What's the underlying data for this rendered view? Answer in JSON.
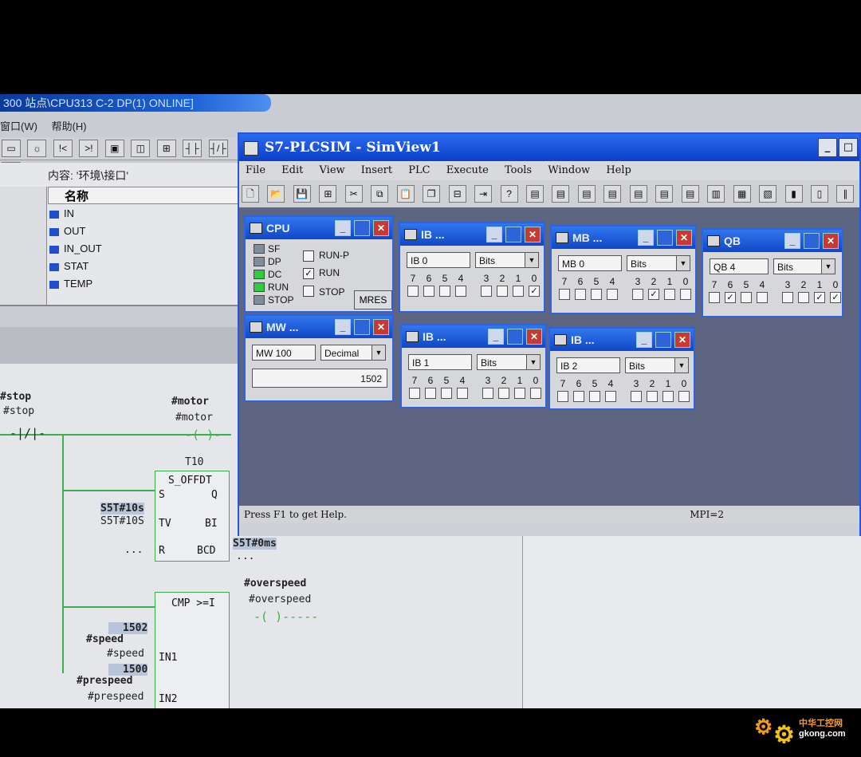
{
  "editor": {
    "title": "300 站点\\CPU313 C-2 DP(1)  ONLINE]",
    "menu": [
      "窗口(W)",
      "帮助(H)"
    ],
    "toolbar_icons": [
      "step-icon",
      "online-icon",
      "left-arrow-icon",
      "right-arrow-icon",
      "window-icon",
      "monitor-icon",
      "network-icon",
      "contact-icon",
      "neg-contact-icon",
      "coil-icon"
    ],
    "interface_header": "内容: '环境\\接口'",
    "column_header": "名称",
    "interface_rows": [
      "IN",
      "OUT",
      "IN_OUT",
      "STAT",
      "TEMP"
    ]
  },
  "ladder": {
    "stop_label_top": "#stop",
    "stop_label": "#stop",
    "motor_label_top": "#motor",
    "motor_label": "#motor",
    "timer_name": "T10",
    "timer_type": "S_OFFDT",
    "pin_s": "S",
    "pin_q": "Q",
    "pin_tv": "TV",
    "pin_bi": "BI",
    "pin_r": "R",
    "pin_bcd": "BCD",
    "tv_value": "S5T#10s",
    "tv_operand": "S5T#10S",
    "r_operand": "...",
    "bi_operand": "...",
    "bcd_value": "S5T#0ms",
    "bcd_operand": "...",
    "cmp_type": "CMP >=I",
    "overspeed_top": "#overspeed",
    "overspeed": "#overspeed",
    "speed_value": "1502",
    "speed_top": "#speed",
    "speed": "#speed",
    "pin_in1": "IN1",
    "prespeed_value": "1500",
    "prespeed_top": "#prespeed",
    "prespeed": "#prespeed",
    "pin_in2": "IN2"
  },
  "plcsim": {
    "title": "S7-PLCSIM - SimView1",
    "menu": [
      "File",
      "Edit",
      "View",
      "Insert",
      "PLC",
      "Execute",
      "Tools",
      "Window",
      "Help"
    ],
    "status_text": "Press F1 to get Help.",
    "status_mpi": "MPI=2",
    "cpu": {
      "title": "CPU",
      "leds": [
        {
          "label": "SF",
          "color": "#7f8c99"
        },
        {
          "label": "DP",
          "color": "#7f8c99"
        },
        {
          "label": "DC",
          "color": "#2ecc40"
        },
        {
          "label": "RUN",
          "color": "#2ecc40"
        },
        {
          "label": "STOP",
          "color": "#7f8c99"
        }
      ],
      "mode_runp": "RUN-P",
      "mode_run": "RUN",
      "mode_stop": "STOP",
      "mres": "MRES"
    },
    "ib0": {
      "title": "IB ...",
      "area": "IB  0",
      "format": "Bits",
      "checked": [
        false,
        false,
        false,
        false,
        false,
        false,
        false,
        true
      ]
    },
    "mb0": {
      "title": "MB ...",
      "area": "MB  0",
      "format": "Bits",
      "checked": [
        false,
        false,
        false,
        false,
        false,
        true,
        false,
        false
      ]
    },
    "qb4": {
      "title": "QB",
      "area": "QB  4",
      "format": "Bits",
      "checked": [
        false,
        true,
        false,
        false,
        false,
        false,
        true,
        true
      ]
    },
    "mw": {
      "title": "MW ...",
      "area": "MW  100",
      "format": "Decimal",
      "value": "1502"
    },
    "ib1": {
      "title": "IB ...",
      "area": "IB  1",
      "format": "Bits",
      "checked": [
        false,
        false,
        false,
        false,
        false,
        false,
        false,
        false
      ]
    },
    "ib2": {
      "title": "IB ...",
      "area": "IB  2",
      "format": "Bits",
      "checked": [
        false,
        false,
        false,
        false,
        false,
        false,
        false,
        false
      ]
    },
    "bit_labels": [
      "7",
      "6",
      "5",
      "4",
      "3",
      "2",
      "1",
      "0"
    ]
  },
  "watermark": {
    "name": "中华工控网",
    "url": "gkong.com"
  }
}
